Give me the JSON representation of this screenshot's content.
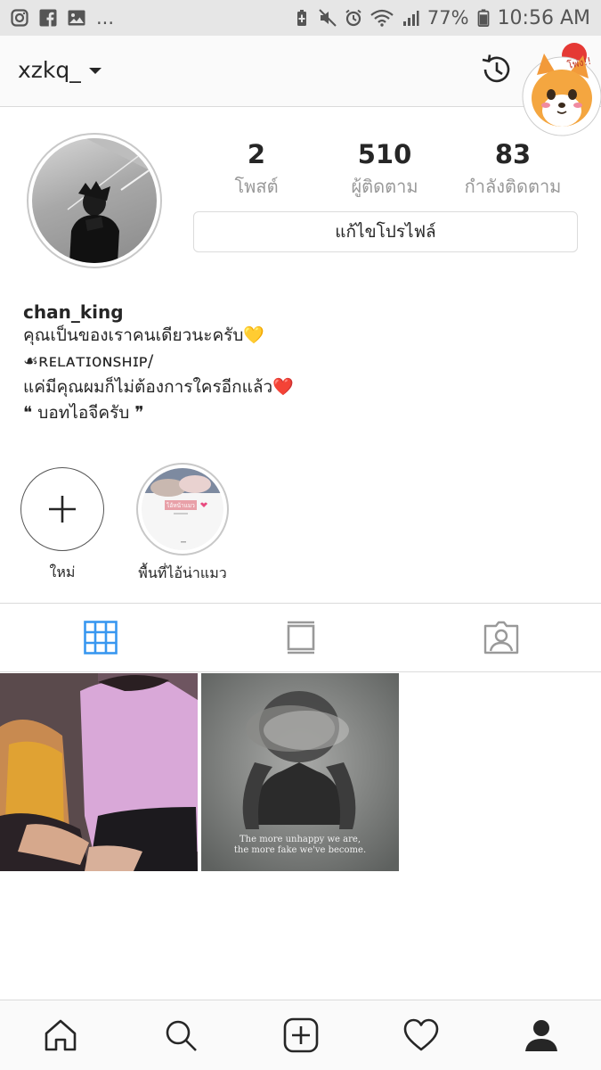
{
  "status_bar": {
    "left_icons": [
      "instagram-icon",
      "facebook-icon",
      "gallery-icon"
    ],
    "overflow": "...",
    "right_icons": [
      "battery-saver-icon",
      "mute-icon",
      "alarm-icon",
      "wifi-icon",
      "signal-icon"
    ],
    "battery_percent": "77%",
    "time": "10:56 AM"
  },
  "header": {
    "username": "xzkq_",
    "history_icon": "history-icon",
    "sticker_text": "โพ่ง!!"
  },
  "profile": {
    "stats": [
      {
        "value": "2",
        "label": "โพสต์"
      },
      {
        "value": "510",
        "label": "ผู้ติดตาม"
      },
      {
        "value": "83",
        "label": "กำลังติดตาม"
      }
    ],
    "edit_button": "แก้ไขโปรไฟล์",
    "display_name": "chan_king",
    "bio_lines": [
      "คุณเป็นของเราคนเดียวนะครับ💛",
      "☙ʀᴇʟᴀᴛɪᴏɴsʜɪᴘ/",
      "แค่มีคุณผมก็ไม่ต้องการใครอีกแล้ว❤️",
      "❝ บอทไอจีครับ ❞"
    ]
  },
  "highlights": [
    {
      "label": "ใหม่",
      "icon": "plus-icon"
    },
    {
      "label": "พื้นที่ไอ้น่าแมว",
      "cover_text": "ไอ้หน้าแมว"
    }
  ],
  "tabs": [
    "grid-icon",
    "feed-icon",
    "tagged-icon"
  ],
  "active_tab": 0,
  "accent_color": "#3897f0",
  "posts": [
    {
      "caption": ""
    },
    {
      "caption_line1": "The more unhappy we are,",
      "caption_line2": "the more fake we've become."
    }
  ],
  "bottom_nav": [
    "home-icon",
    "search-icon",
    "add-icon",
    "heart-icon",
    "profile-icon"
  ]
}
